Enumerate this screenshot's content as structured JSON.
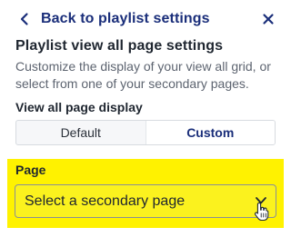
{
  "header": {
    "back_label": "Back to playlist settings",
    "back_icon": "chevron-left-icon",
    "close_icon": "close-icon"
  },
  "panel": {
    "title": "Playlist view all page settings",
    "description": "Customize the display of your view all grid, or select from one of your secondary pages."
  },
  "view_display": {
    "label": "View all page display",
    "options": [
      "Default",
      "Custom"
    ],
    "selected": "Custom"
  },
  "page_select": {
    "label": "Page",
    "value": "Select a secondary page",
    "icon": "chevron-down-icon"
  },
  "cursor": {
    "icon": "hand-pointer-icon"
  },
  "colors": {
    "accent": "#1a2e7a",
    "highlight": "#fff200",
    "text": "#1f2630",
    "muted": "#5d6470"
  }
}
